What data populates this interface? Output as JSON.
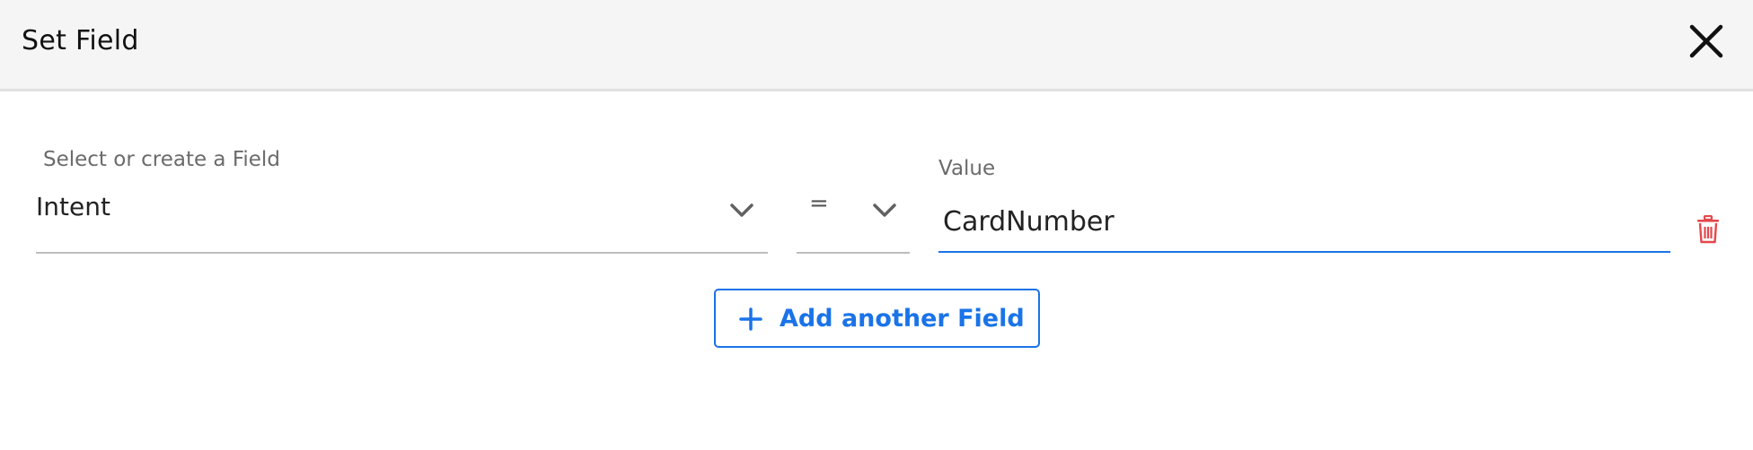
{
  "dialog": {
    "title": "Set Field",
    "close_icon": "close-icon"
  },
  "field_row": {
    "field_label": "Select or create a Field",
    "field_value": "Intent",
    "operator_value": "=",
    "value_label": "Value",
    "value_text": "CardNumber",
    "delete_icon": "trash-icon"
  },
  "actions": {
    "add_label": "Add another Field",
    "add_icon": "plus-icon"
  },
  "colors": {
    "accent": "#1a73e8",
    "delete": "#e5484d",
    "header_bg": "#f5f5f5"
  }
}
